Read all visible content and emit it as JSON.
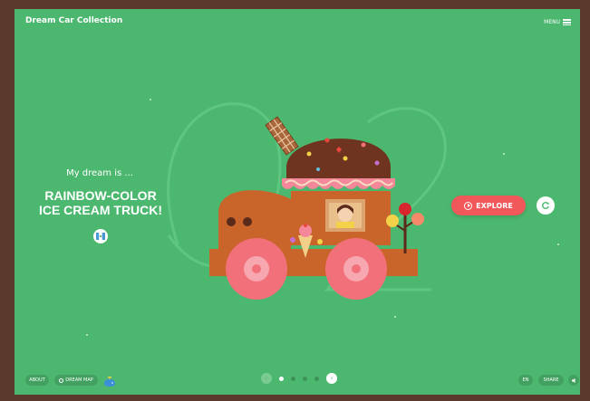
{
  "header": {
    "logo_text": "Dream Car Collection",
    "menu_label": "MENU"
  },
  "hero": {
    "lead": "My dream is ...",
    "title_line1": "RAINBOW-COLOR",
    "title_line2": "ICE CREAM TRUCK!",
    "flag_icon": "guatemala-flag-icon",
    "explore_label": "EXPLORE",
    "refresh_icon": "refresh-icon"
  },
  "footer": {
    "about_label": "ABOUT",
    "dream_map_label": "DREAM MAP",
    "lang_label": "EN",
    "share_label": "SHARE",
    "sound_icon": "speaker-icon",
    "pager": {
      "total_dots": 4,
      "active_index": 0
    }
  },
  "colors": {
    "background": "#4cb86f",
    "accent": "#f0585a",
    "truck_body": "#c9642a",
    "wheel": "#f2707a"
  }
}
